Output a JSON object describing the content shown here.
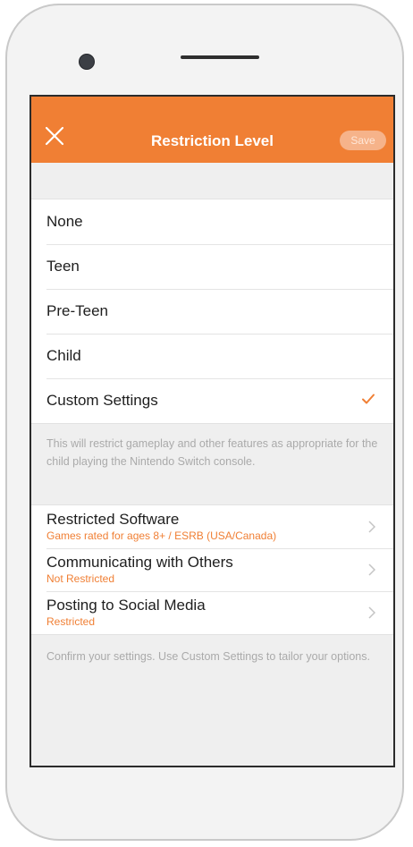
{
  "header": {
    "title": "Restriction Level",
    "save_label": "Save"
  },
  "options": [
    {
      "label": "None"
    },
    {
      "label": "Teen"
    },
    {
      "label": "Pre-Teen"
    },
    {
      "label": "Child"
    },
    {
      "label": "Custom Settings",
      "selected": true
    }
  ],
  "options_note": "This will restrict gameplay and other features as appropriate for the child playing the Nintendo Switch console.",
  "settings": [
    {
      "title": "Restricted Software",
      "subtitle": "Games rated for ages 8+ / ESRB (USA/Canada)"
    },
    {
      "title": "Communicating with Others",
      "subtitle": "Not Restricted"
    },
    {
      "title": "Posting to Social Media",
      "subtitle": "Restricted"
    }
  ],
  "footer_note": "Confirm your settings. Use Custom Settings to tailor your options.",
  "colors": {
    "accent": "#f07f34",
    "save_bg": "#f6b38a",
    "muted_text": "#aaaaaa"
  },
  "icons": {
    "close": "close-icon",
    "check": "checkmark-icon",
    "chevron": "chevron-right-icon"
  }
}
